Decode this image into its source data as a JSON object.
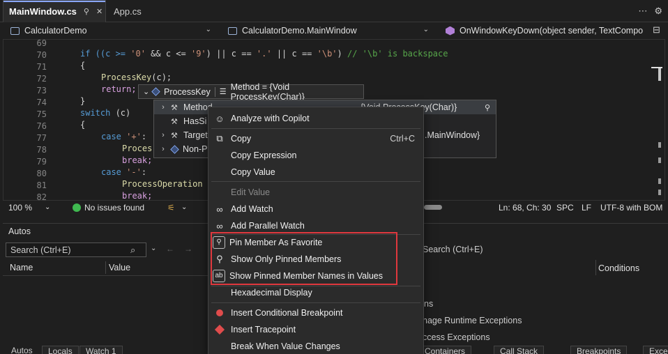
{
  "tabs": [
    {
      "label": "MainWindow.cs",
      "active": true
    },
    {
      "label": "App.cs",
      "active": false
    }
  ],
  "navbar": {
    "project": "CalculatorDemo",
    "class": "CalculatorDemo.MainWindow",
    "member": "OnWindowKeyDown(object sender, TextCompo"
  },
  "editor": {
    "line_numbers": [
      "69",
      "70",
      "71",
      "72",
      "73",
      "74",
      "75",
      "76",
      "77",
      "78",
      "79",
      "80",
      "81",
      "82"
    ],
    "lines": {
      "l70_a": "if ((c >= ",
      "l70_s1": "'0'",
      "l70_b": " && c <= ",
      "l70_s2": "'9'",
      "l70_c": ") || c == ",
      "l70_s3": "'.'",
      "l70_d": " || c == ",
      "l70_s4": "'\\b'",
      "l70_e": ") ",
      "l70_cm": "// '\\b' is backspace",
      "l71": "{",
      "l72_fn": "ProcessKey",
      "l72_rest": "(c);",
      "l73": "return;",
      "l74": "}",
      "l75_kw": "switch",
      "l75_rest": " (c)",
      "l76": "{",
      "l77_kw": "case",
      "l77_s": " '+'",
      "l77_rest": ":",
      "l78": "Proces",
      "l79": "break;",
      "l80_kw": "case",
      "l80_s": " '-'",
      "l80_rest": ":",
      "l81": "ProcessOperation",
      "l82": "break;"
    }
  },
  "status": {
    "zoom": "100 %",
    "issues": "No issues found",
    "position": "Ln: 68, Ch: 30",
    "spacing": "SPC",
    "line_ending": "LF",
    "encoding": "UTF-8 with BOM"
  },
  "autos": {
    "title": "Autos",
    "search_placeholder": "Search (Ctrl+E)",
    "col_name": "Name",
    "col_value": "Value"
  },
  "right_panel": {
    "search": "Search (Ctrl+E)",
    "col_conditions": "Conditions",
    "items": [
      "ns",
      "nage Runtime Exceptions",
      "ccess Exceptions"
    ]
  },
  "bottom_tabs": [
    "Autos",
    "Locals",
    "Watch 1",
    "Containers",
    "Call Stack",
    "Breakpoints",
    "Excep"
  ],
  "datatip": {
    "name": "ProcessKey",
    "value": "Method = {Void ProcessKey(Char)}"
  },
  "tip_rows": [
    {
      "label": "Method",
      "value": "{Void ProcessKey(Char)}"
    },
    {
      "label": "HasSi",
      "value": ""
    },
    {
      "label": "Target",
      "value": ".MainWindow}"
    },
    {
      "label": "Non-P",
      "value": ""
    }
  ],
  "context_menu": {
    "analyze": "Analyze with Copilot",
    "copy": "Copy",
    "copy_shortcut": "Ctrl+C",
    "copy_expression": "Copy Expression",
    "copy_value": "Copy Value",
    "edit_value": "Edit Value",
    "add_watch": "Add Watch",
    "add_parallel_watch": "Add Parallel Watch",
    "pin_member": "Pin Member As Favorite",
    "show_pinned": "Show Only Pinned Members",
    "show_pinned_names": "Show Pinned Member Names in Values",
    "hex_display": "Hexadecimal Display",
    "insert_bp": "Insert Conditional Breakpoint",
    "insert_tp": "Insert Tracepoint",
    "break_when": "Break When Value Changes"
  }
}
